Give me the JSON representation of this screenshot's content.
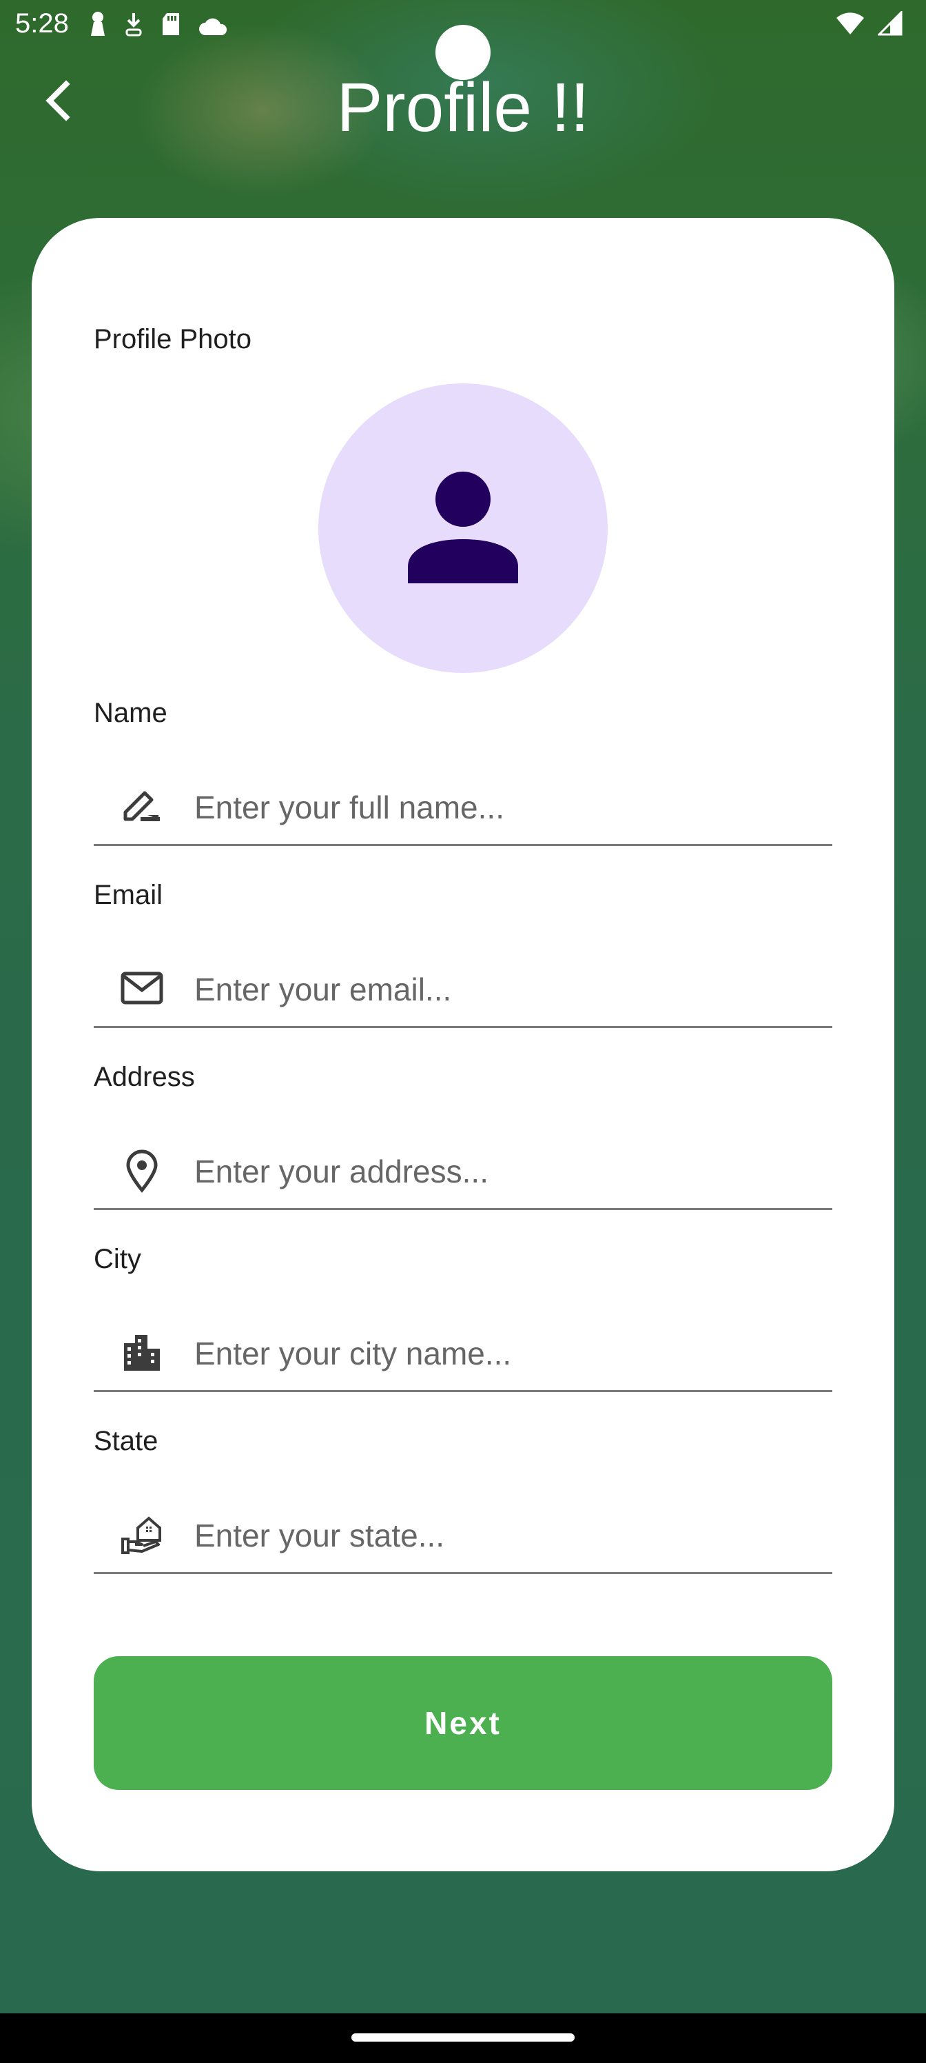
{
  "status_bar": {
    "time": "5:28",
    "left_icons": [
      "keyhole-icon",
      "download-icon",
      "sd-card-icon",
      "cloud-icon"
    ],
    "right_icons": [
      "wifi-icon",
      "signal-icon"
    ]
  },
  "header": {
    "title": "Profile !!",
    "back_icon": "chevron-left-icon"
  },
  "form": {
    "photo_label": "Profile Photo",
    "avatar_icon": "person-icon",
    "fields": [
      {
        "label": "Name",
        "placeholder": "Enter your full name...",
        "icon": "pencil-icon"
      },
      {
        "label": "Email",
        "placeholder": "Enter your email...",
        "icon": "envelope-icon"
      },
      {
        "label": "Address",
        "placeholder": "Enter your address...",
        "icon": "location-pin-icon"
      },
      {
        "label": "City",
        "placeholder": "Enter your city name...",
        "icon": "city-buildings-icon"
      },
      {
        "label": "State",
        "placeholder": "Enter your state...",
        "icon": "home-hand-icon"
      }
    ],
    "next_label": "Next"
  },
  "colors": {
    "accent": "#4caf50",
    "avatar_bg": "#e8dcfd",
    "avatar_fg": "#22005d",
    "icon": "#3c3c3c"
  }
}
